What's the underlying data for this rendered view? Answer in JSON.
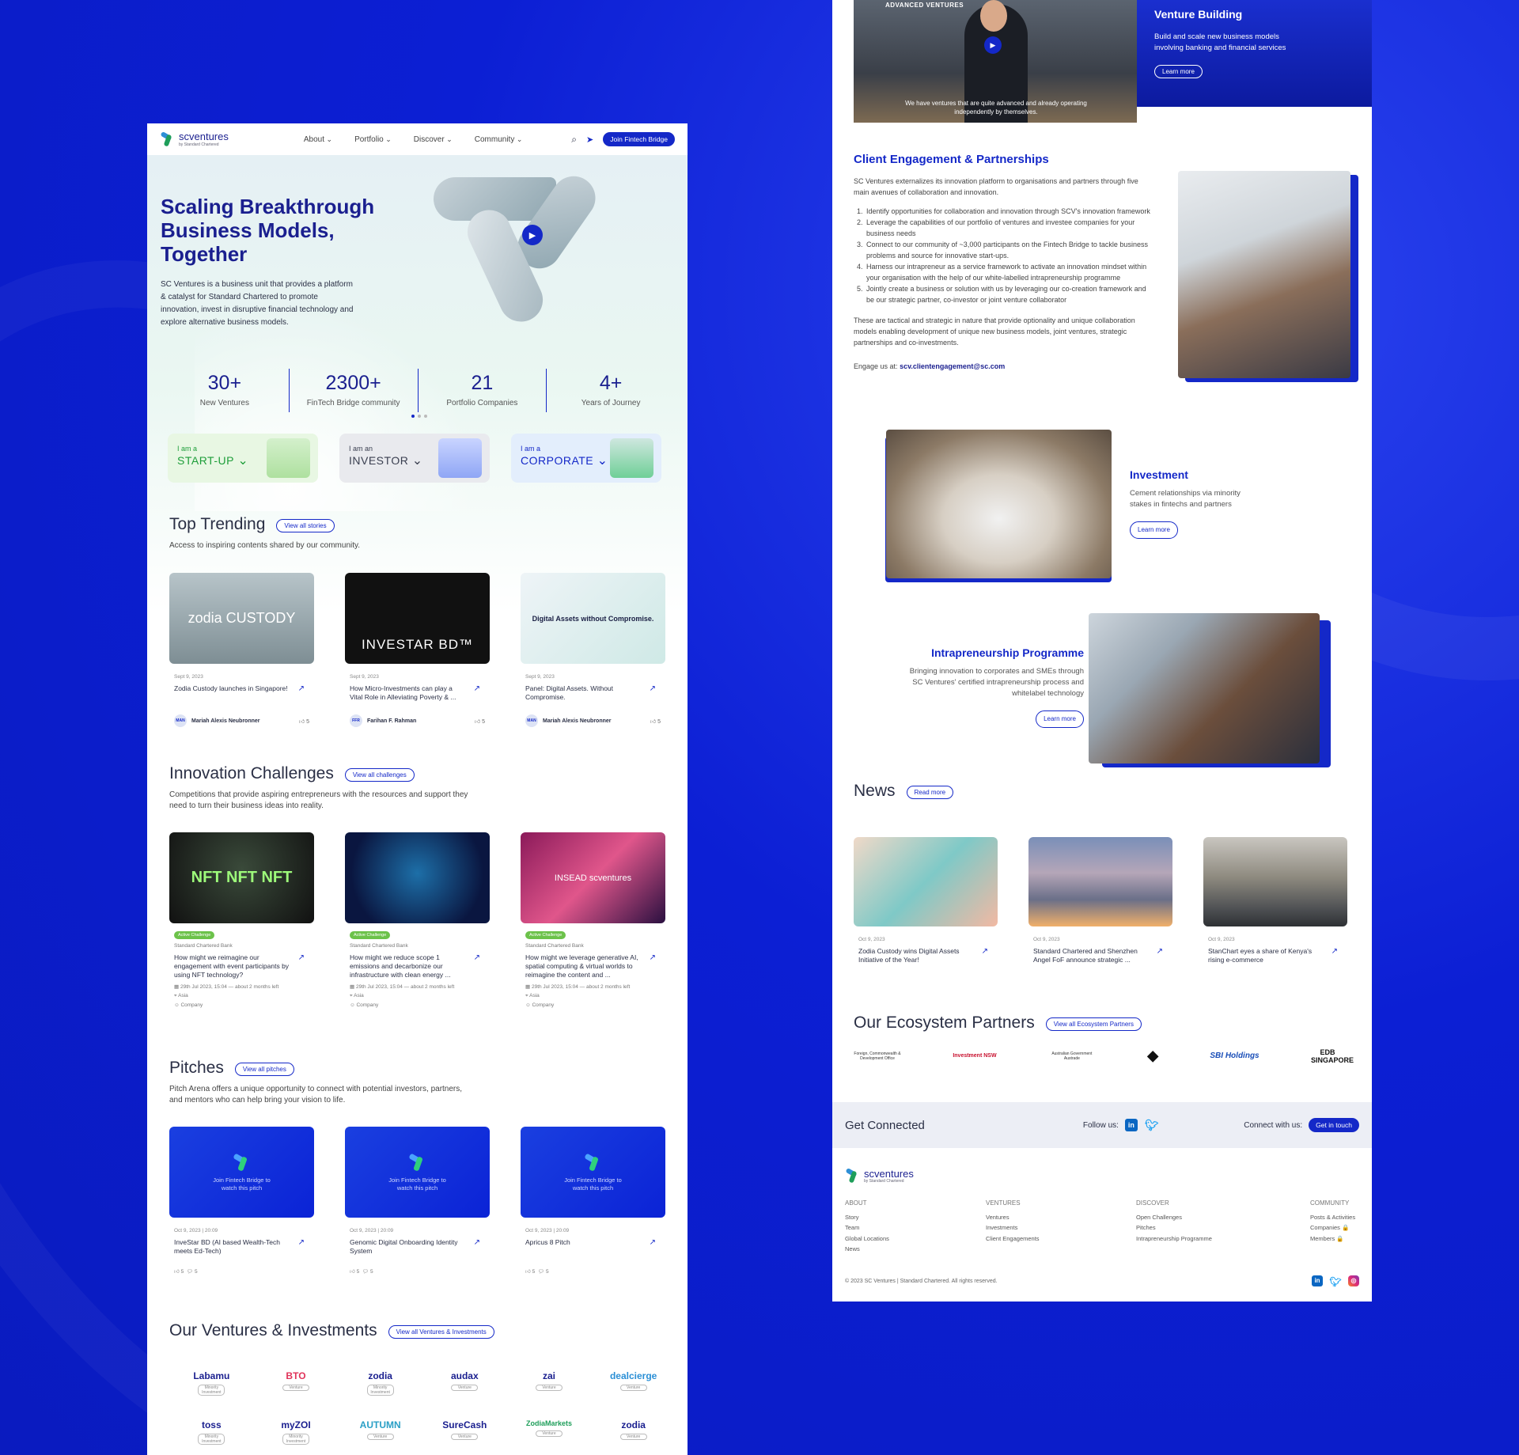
{
  "nav": {
    "logo": "scventures",
    "logo_sub": "by Standard Chartered",
    "items": [
      "About",
      "Portfolio",
      "Discover",
      "Community"
    ],
    "cta": "Join Fintech Bridge"
  },
  "hero": {
    "title": "Scaling Breakthrough Business Models, Together",
    "body": "SC Ventures is a business unit that provides a platform & catalyst for Standard Chartered to promote innovation, invest in disruptive financial technology and explore alternative business models.",
    "stats": [
      {
        "value": "30+",
        "label": "New Ventures"
      },
      {
        "value": "2300+",
        "label": "FinTech Bridge community"
      },
      {
        "value": "21",
        "label": "Portfolio Companies"
      },
      {
        "value": "4+",
        "label": "Years of Journey"
      }
    ]
  },
  "roles": [
    {
      "pre": "I am a",
      "name": "START-UP",
      "color": "#1e9e3a",
      "bg": "#e8f7e3"
    },
    {
      "pre": "I am an",
      "name": "INVESTOR",
      "color": "#3a3f50",
      "bg": "#e9eaee"
    },
    {
      "pre": "I am a",
      "name": "CORPORATE",
      "color": "#1428c8",
      "bg": "#e3eefc"
    }
  ],
  "trending": {
    "title": "Top Trending",
    "btn": "View all stories",
    "desc": "Access to inspiring contents shared by our community.",
    "cards": [
      {
        "img_text": "zodia CUSTODY",
        "date": "Sept 9, 2023",
        "title": "Zodia Custody launches in Singapore!",
        "initials": "MAN",
        "author": "Mariah Alexis Neubronner",
        "likes": "5"
      },
      {
        "img_text": "INVESTAR BD™",
        "date": "Sept 9, 2023",
        "title": "How Micro-Investments can play a Vital Role in Alleviating Poverty & ...",
        "initials": "FFR",
        "author": "Farihan F. Rahman",
        "likes": "5"
      },
      {
        "img_text": "Digital Assets without Compromise.",
        "date": "Sept 9, 2023",
        "title": "Panel: Digital Assets. Without Compromise.",
        "initials": "MAN",
        "author": "Mariah Alexis Neubronner",
        "likes": "5"
      }
    ]
  },
  "challenges": {
    "title": "Innovation Challenges",
    "btn": "View all challenges",
    "desc": "Competitions that provide aspiring entrepreneurs with the resources and support they need to turn their business ideas into reality.",
    "badge": "Active Challenge",
    "org": "Standard Chartered Bank",
    "date": "29th Jul 2023, 15:04 — about 2 months left",
    "region": "Asia",
    "type": "Company",
    "cards": [
      {
        "img_text": "NFT NFT NFT",
        "title": "How might we reimagine our engagement with event participants by using NFT technology?"
      },
      {
        "img_text": "",
        "title": "How might we reduce scope 1 emissions and decarbonize our infrastructure with clean energy ..."
      },
      {
        "img_text": "INSEAD scventures",
        "title": "How might we leverage generative AI, spatial computing & virtual worlds to reimagine the content and ..."
      }
    ]
  },
  "pitches": {
    "title": "Pitches",
    "btn": "View all pitches",
    "desc": "Pitch Arena offers a unique opportunity to connect with potential investors, partners, and mentors who can help bring your vision to life.",
    "overlay": "Join Fintech Bridge to watch this pitch",
    "date": "Oct 9, 2023 | 20:09",
    "cards": [
      {
        "title": "InveStar BD (AI based Wealth-Tech meets Ed-Tech)",
        "likes": "5",
        "comments": "5"
      },
      {
        "title": "Genomic Digital Onboarding Identity System",
        "likes": "5",
        "comments": "5"
      },
      {
        "title": "Apricus 8 Pitch",
        "likes": "5",
        "comments": "5"
      }
    ]
  },
  "ventures": {
    "title": "Our Ventures & Investments",
    "btn": "View all Ventures & Investments",
    "logos": [
      {
        "name": "Labamu",
        "tag": "Minority Investment"
      },
      {
        "name": "BTO",
        "tag": "Venture"
      },
      {
        "name": "zodia",
        "tag": "Minority Investment"
      },
      {
        "name": "audax",
        "tag": "Venture"
      },
      {
        "name": "zai",
        "tag": "Venture"
      },
      {
        "name": "dealcierge",
        "tag": "Venture"
      },
      {
        "name": "toss",
        "tag": "Minority Investment"
      },
      {
        "name": "myZOI",
        "tag": "Minority Investment"
      },
      {
        "name": "AUTUMN",
        "tag": "Venture"
      },
      {
        "name": "SureCash",
        "tag": "Venture"
      },
      {
        "name": "ZodiaMarkets",
        "tag": "Venture"
      },
      {
        "name": "zodia",
        "tag": "Venture"
      }
    ]
  },
  "video": {
    "tag": "ADVANCED VENTURES",
    "caption": "We have ventures that are quite advanced and already operating independently by themselves."
  },
  "venture_building": {
    "title": "Venture Building",
    "body": "Build and scale new business models involving banking and financial services",
    "btn": "Learn more"
  },
  "client": {
    "title": "Client Engagement & Partnerships",
    "intro": "SC Ventures externalizes its innovation platform to organisations and partners through five main avenues of collaboration and innovation.",
    "items": [
      "Identify opportunities for collaboration and innovation through SCV's innovation framework",
      "Leverage the capabilities of our portfolio of ventures and investee companies for your business needs",
      "Connect to our community of ~3,000 participants on the Fintech Bridge to tackle business problems and source for innovative start-ups.",
      "Harness our intrapreneur as a service framework to activate an innovation mindset within your organisation with the help of our white-labelled intrapreneurship programme",
      "Jointly create a business or solution with us by leveraging our co-creation framework and be our strategic partner, co-investor or joint venture collaborator"
    ],
    "outro": "These are tactical and strategic in nature that provide optionality and unique collaboration models enabling development of unique new business models, joint ventures, strategic partnerships and co-investments.",
    "engage": "Engage us at:",
    "email": "scv.clientengagement@sc.com"
  },
  "investment": {
    "title": "Investment",
    "body": "Cement relationships via minority stakes in fintechs and partners",
    "btn": "Learn more"
  },
  "intra": {
    "title": "Intrapreneurship Programme",
    "body": "Bringing innovation to corporates and SMEs through SC Ventures' certified intrapreneurship process and whitelabel technology",
    "btn": "Learn more"
  },
  "news": {
    "title": "News",
    "btn": "Read more",
    "cards": [
      {
        "date": "Oct 9, 2023",
        "title": "Zodia Custody wins Digital Assets Initiative of the Year!"
      },
      {
        "date": "Oct 9, 2023",
        "title": "Standard Chartered and Shenzhen Angel FoF announce strategic ..."
      },
      {
        "date": "Oct 9, 2023",
        "title": "StanChart eyes a share of Kenya's rising e-commerce"
      }
    ]
  },
  "partners": {
    "title": "Our Ecosystem Partners",
    "btn": "View all Ecosystem Partners",
    "logos": [
      "Foreign, Commonwealth & Development Office",
      "Investment NSW",
      "Australian Government Austrade",
      "◆",
      "SBI Holdings",
      "EDB SINGAPORE"
    ]
  },
  "connect": {
    "title": "Get Connected",
    "follow": "Follow us:",
    "connect": "Connect with us:",
    "btn": "Get in touch"
  },
  "footer": {
    "cols": [
      {
        "h": "ABOUT",
        "items": [
          "Story",
          "Team",
          "Global Locations",
          "News"
        ]
      },
      {
        "h": "VENTURES",
        "items": [
          "Ventures",
          "Investments",
          "Client Engagements"
        ]
      },
      {
        "h": "DISCOVER",
        "items": [
          "Open Challenges",
          "Pitches",
          "Intrapreneurship Programme"
        ]
      },
      {
        "h": "COMMUNITY",
        "items": [
          "Posts & Activities",
          "Companies 🔒",
          "Members 🔒"
        ]
      }
    ],
    "copyright": "© 2023 SC Ventures | Standard Chartered. All rights reserved."
  }
}
